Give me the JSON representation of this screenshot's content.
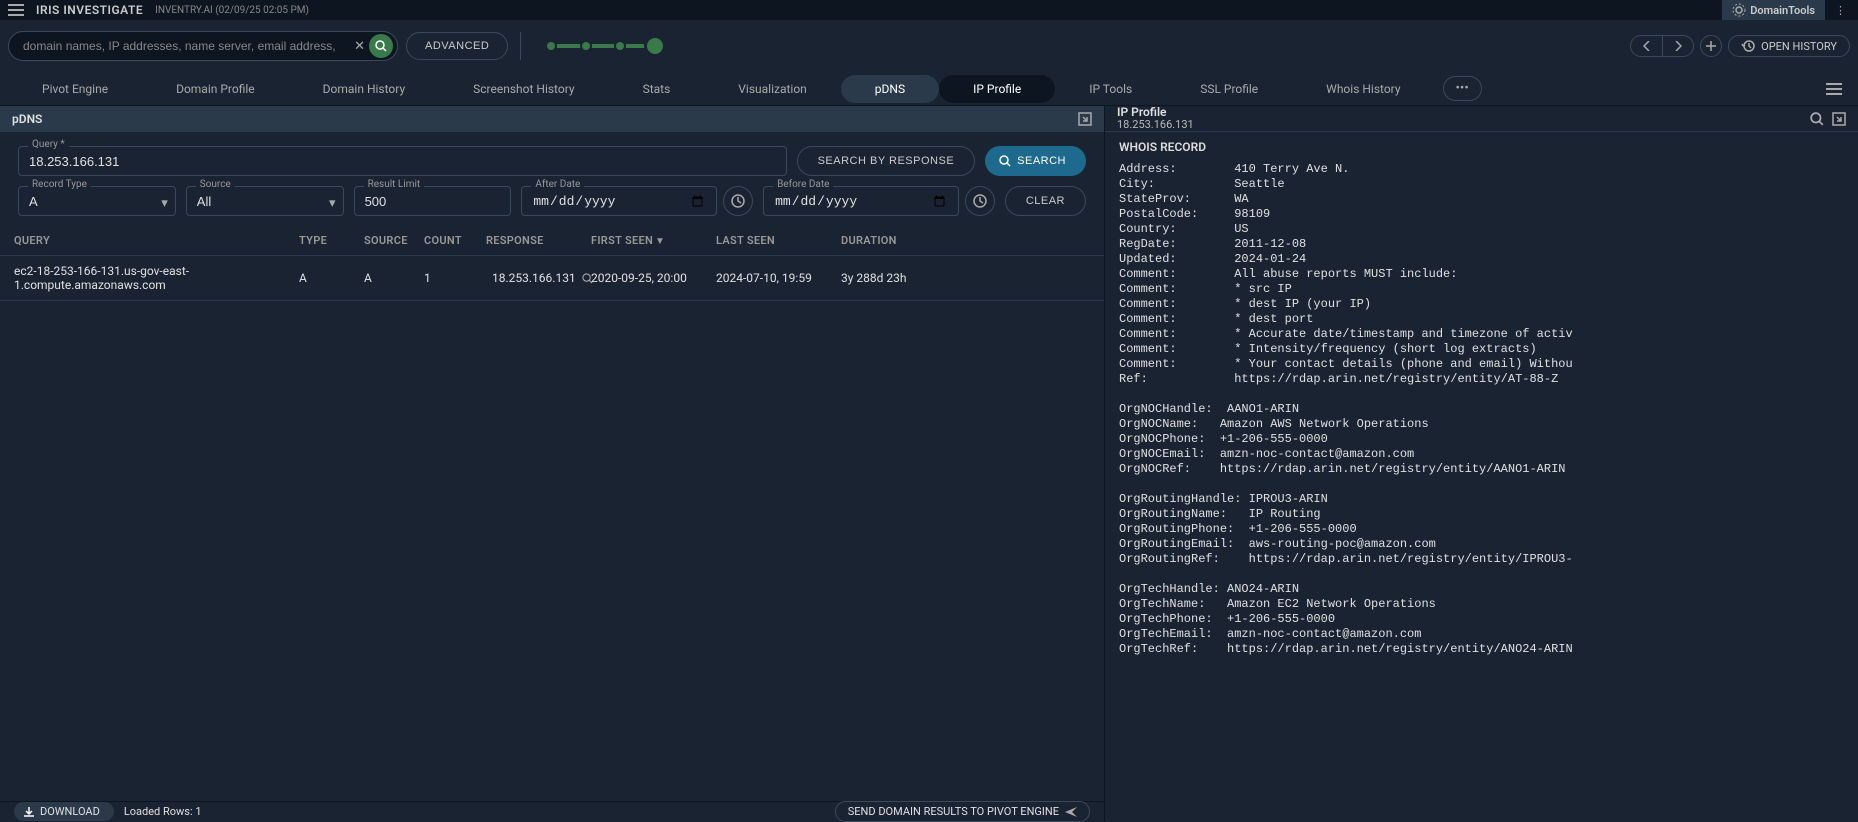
{
  "topbar": {
    "app_title": "IRIS INVESTIGATE",
    "subtitle": "INVENTRY.AI (02/09/25 02:05 PM)",
    "brand": "DomainTools"
  },
  "search": {
    "placeholder": "domain names, IP addresses, name server, email address,",
    "advanced_label": "ADVANCED",
    "open_history_label": "OPEN HISTORY"
  },
  "tabs": {
    "items": [
      "Pivot Engine",
      "Domain Profile",
      "Domain History",
      "Screenshot History",
      "Stats",
      "Visualization",
      "pDNS",
      "IP Profile",
      "IP Tools",
      "SSL Profile",
      "Whois History"
    ],
    "active_index": 6
  },
  "pdns_panel": {
    "title": "pDNS",
    "form": {
      "query_label": "Query *",
      "query_value": "18.253.166.131",
      "search_by_response_label": "SEARCH BY RESPONSE",
      "search_label": "SEARCH",
      "record_type_label": "Record Type",
      "record_type_value": "A",
      "source_label": "Source",
      "source_value": "All",
      "result_limit_label": "Result Limit",
      "result_limit_value": "500",
      "after_date_label": "After Date",
      "after_date_placeholder": "mm/dd/yyyy",
      "before_date_label": "Before Date",
      "before_date_placeholder": "mm/dd/yyyy",
      "clear_label": "CLEAR"
    },
    "columns": {
      "query": "QUERY",
      "type": "TYPE",
      "source": "SOURCE",
      "count": "COUNT",
      "response": "RESPONSE",
      "first_seen": "FIRST SEEN",
      "last_seen": "LAST SEEN",
      "duration": "DURATION"
    },
    "rows": [
      {
        "query": "ec2-18-253-166-131.us-gov-east-1.compute.amazonaws.com",
        "type": "A",
        "source": "A",
        "count": "1",
        "response": "18.253.166.131",
        "first_seen": "2020-09-25, 20:00",
        "last_seen": "2024-07-10, 19:59",
        "duration": "3y 288d 23h"
      }
    ],
    "footer": {
      "download_label": "DOWNLOAD",
      "loaded_rows_label": "Loaded Rows: ",
      "loaded_rows_value": "1",
      "send_label": "SEND DOMAIN RESULTS TO PIVOT ENGINE"
    }
  },
  "ip_panel": {
    "title": "IP Profile",
    "subtitle": "18.253.166.131",
    "whois_title": "WHOIS RECORD",
    "whois_lines": [
      "Address:        410 Terry Ave N.",
      "City:           Seattle",
      "StateProv:      WA",
      "PostalCode:     98109",
      "Country:        US",
      "RegDate:        2011-12-08",
      "Updated:        2024-01-24",
      "Comment:        All abuse reports MUST include:",
      "Comment:        * src IP",
      "Comment:        * dest IP (your IP)",
      "Comment:        * dest port",
      "Comment:        * Accurate date/timestamp and timezone of activ",
      "Comment:        * Intensity/frequency (short log extracts)",
      "Comment:        * Your contact details (phone and email) Withou",
      "Ref:            https://rdap.arin.net/registry/entity/AT-88-Z",
      "",
      "OrgNOCHandle:  AANO1-ARIN",
      "OrgNOCName:   Amazon AWS Network Operations",
      "OrgNOCPhone:  +1-206-555-0000",
      "OrgNOCEmail:  amzn-noc-contact@amazon.com",
      "OrgNOCRef:    https://rdap.arin.net/registry/entity/AANO1-ARIN",
      "",
      "OrgRoutingHandle: IPROU3-ARIN",
      "OrgRoutingName:   IP Routing",
      "OrgRoutingPhone:  +1-206-555-0000",
      "OrgRoutingEmail:  aws-routing-poc@amazon.com",
      "OrgRoutingRef:    https://rdap.arin.net/registry/entity/IPROU3-",
      "",
      "OrgTechHandle: ANO24-ARIN",
      "OrgTechName:   Amazon EC2 Network Operations",
      "OrgTechPhone:  +1-206-555-0000",
      "OrgTechEmail:  amzn-noc-contact@amazon.com",
      "OrgTechRef:    https://rdap.arin.net/registry/entity/ANO24-ARIN"
    ]
  }
}
